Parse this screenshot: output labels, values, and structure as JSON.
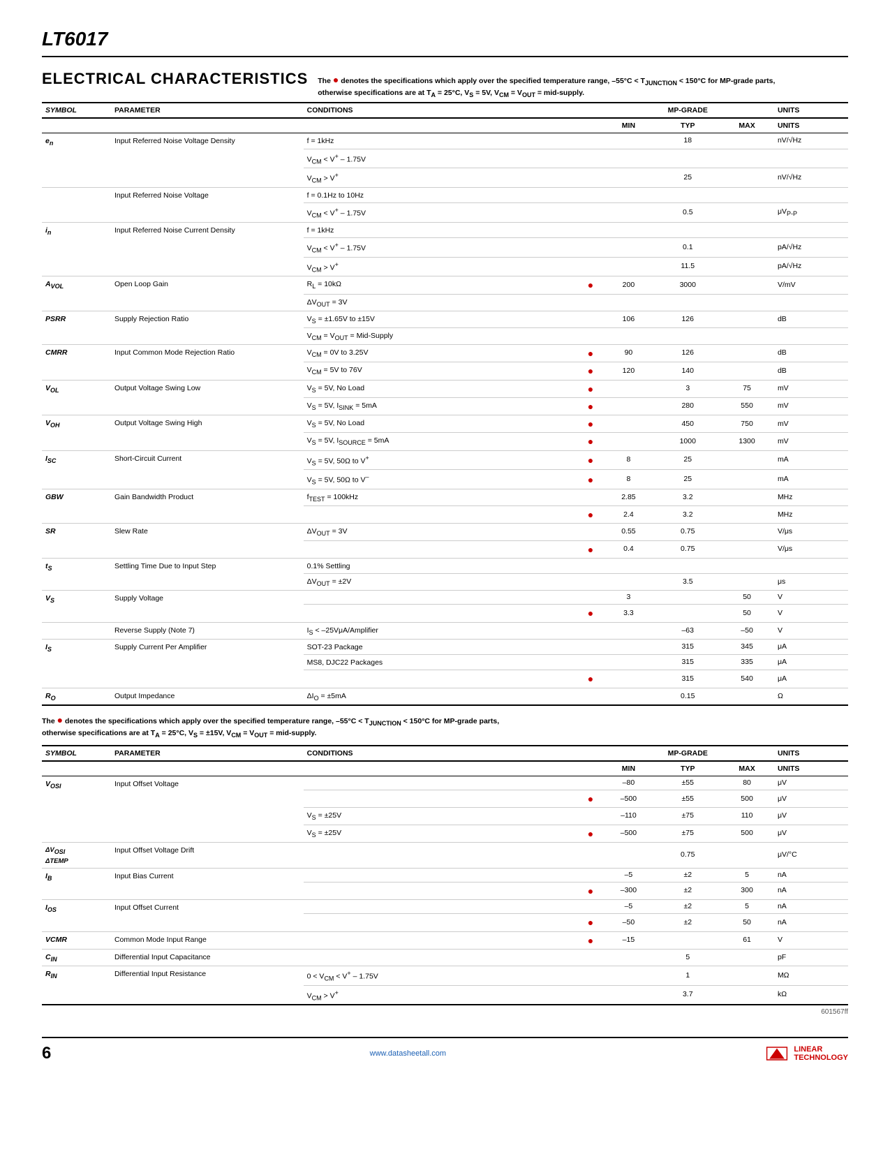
{
  "doc": {
    "title": "LT6017",
    "page": "6",
    "url": "www.datasheetall.com",
    "doc_number": "601567ff"
  },
  "section1": {
    "title": "ELECTRICAL CHARACTERISTICS",
    "desc": "The ● denotes the specifications which apply over the specified temperature range, –55°C < T",
    "desc2": "JUNCTION",
    "desc3": " < 150°C for MP-grade parts, otherwise specifications are at T",
    "desc4": "A",
    "desc5": " = 25°C, V",
    "desc6": "S",
    "desc7": " = 5V, V",
    "desc8": "CM",
    "desc9": " = V",
    "desc10": "OUT",
    "desc11": " = mid-supply.",
    "note": "The ● denotes the specifications which apply over the specified temperature range, –55°C < T",
    "note2": "JUNCTION",
    "note3": " < 150°C for MP-grade parts, otherwise specifications are at T",
    "note4": "A",
    "note5": " = 25°C, V",
    "note6": "S",
    "note7": " = ±15V, V",
    "note8": "CM",
    "note9": " = V",
    "note10": "OUT",
    "note11": " = mid-supply.",
    "table1_cols": [
      "SYMBOL",
      "PARAMETER",
      "CONDITIONS",
      "",
      "MIN",
      "TYP",
      "MAX",
      "UNITS"
    ],
    "table1_rows": [
      {
        "symbol": "en",
        "symbol_sub": "",
        "param": "Input Referred Noise Voltage Density",
        "conds": [
          "f = 1kHz",
          "VCM < V+ – 1.75V",
          "VCM > V+"
        ],
        "dots": [
          "",
          "",
          ""
        ],
        "mins": [
          "",
          "",
          ""
        ],
        "typs": [
          "18",
          "25",
          ""
        ],
        "maxs": [
          "",
          "",
          ""
        ],
        "units": [
          "nV/√Hz",
          "nV/√Hz",
          ""
        ]
      },
      {
        "symbol": "",
        "symbol_sub": "",
        "param": "Input Referred Noise Voltage",
        "conds": [
          "f = 0.1Hz to 10Hz",
          "VCM < V+ – 1.75V"
        ],
        "dots": [
          "",
          ""
        ],
        "mins": [
          "",
          ""
        ],
        "typs": [
          "",
          "0.5"
        ],
        "maxs": [
          "",
          ""
        ],
        "units": [
          "",
          "μVP-P"
        ]
      },
      {
        "symbol": "in",
        "symbol_sub": "",
        "param": "Input Referred Noise Current Density",
        "conds": [
          "f = 1kHz",
          "VCM < V+ – 1.75V",
          "VCM > V+"
        ],
        "dots": [
          "",
          "",
          ""
        ],
        "mins": [
          "",
          "",
          ""
        ],
        "typs": [
          "",
          "0.1",
          "11.5"
        ],
        "maxs": [
          "",
          "",
          ""
        ],
        "units": [
          "",
          "pA/√Hz",
          "pA/√Hz"
        ]
      },
      {
        "symbol": "AVOL",
        "symbol_sub": "",
        "param": "Open Loop Gain",
        "conds": [
          "RL = 10kΩ",
          "ΔVOUT = 3V"
        ],
        "dots": [
          "●",
          ""
        ],
        "mins": [
          "200",
          ""
        ],
        "typs": [
          "3000",
          ""
        ],
        "maxs": [
          "",
          ""
        ],
        "units": [
          "V/mV",
          ""
        ]
      },
      {
        "symbol": "PSRR",
        "symbol_sub": "",
        "param": "Supply Rejection Ratio",
        "conds": [
          "VS = ±1.65V to ±15V",
          "VCM = VOUT = Mid-Supply"
        ],
        "dots": [
          ""
        ],
        "mins": [
          "106"
        ],
        "typs": [
          "126"
        ],
        "maxs": [
          ""
        ],
        "units": [
          "dB"
        ]
      },
      {
        "symbol": "CMRR",
        "symbol_sub": "",
        "param": "Input Common Mode Rejection Ratio",
        "conds": [
          "VCM = 0V to 3.25V",
          "VCM = 5V to 76V"
        ],
        "dots": [
          "●",
          "●"
        ],
        "mins": [
          "90",
          "120"
        ],
        "typs": [
          "126",
          "140"
        ],
        "maxs": [
          "",
          ""
        ],
        "units": [
          "dB",
          "dB"
        ]
      },
      {
        "symbol": "VOL",
        "symbol_sub": "",
        "param": "Output Voltage Swing Low",
        "conds": [
          "VS = 5V, No Load",
          "VS = 5V, ISINK = 5mA"
        ],
        "dots": [
          "●",
          "●"
        ],
        "mins": [
          "",
          ""
        ],
        "typs": [
          "3",
          "280"
        ],
        "maxs": [
          "75",
          "550"
        ],
        "units": [
          "mV",
          "mV"
        ]
      },
      {
        "symbol": "VOH",
        "symbol_sub": "",
        "param": "Output Voltage Swing High",
        "conds": [
          "VS = 5V, No Load",
          "VS = 5V, ISOURCE = 5mA"
        ],
        "dots": [
          "●",
          "●"
        ],
        "mins": [
          "",
          ""
        ],
        "typs": [
          "450",
          "1000"
        ],
        "maxs": [
          "750",
          "1300"
        ],
        "units": [
          "mV",
          "mV"
        ]
      },
      {
        "symbol": "ISC",
        "symbol_sub": "",
        "param": "Short-Circuit Current",
        "conds": [
          "VS = 5V, 50Ω to V+",
          "VS = 5V, 50Ω to V–"
        ],
        "dots": [
          "●",
          "●"
        ],
        "mins": [
          "8",
          "8"
        ],
        "typs": [
          "25",
          "25"
        ],
        "maxs": [
          "",
          ""
        ],
        "units": [
          "mA",
          "mA"
        ]
      },
      {
        "symbol": "GBW",
        "symbol_sub": "",
        "param": "Gain Bandwidth Product",
        "conds": [
          "fTEST = 100kHz",
          ""
        ],
        "dots": [
          "",
          "●"
        ],
        "mins": [
          "2.85",
          "2.4"
        ],
        "typs": [
          "3.2",
          "3.2"
        ],
        "maxs": [
          "",
          ""
        ],
        "units": [
          "MHz",
          "MHz"
        ]
      },
      {
        "symbol": "SR",
        "symbol_sub": "",
        "param": "Slew Rate",
        "conds": [
          "ΔVOUT = 3V",
          ""
        ],
        "dots": [
          "",
          "●"
        ],
        "mins": [
          "0.55",
          "0.4"
        ],
        "typs": [
          "0.75",
          "0.75"
        ],
        "maxs": [
          "",
          ""
        ],
        "units": [
          "V/μs",
          "V/μs"
        ]
      },
      {
        "symbol": "tS",
        "symbol_sub": "",
        "param": "Settling Time Due to Input Step",
        "conds": [
          "0.1% Settling",
          "ΔVOUT = ±2V"
        ],
        "dots": [
          "",
          ""
        ],
        "mins": [
          "",
          ""
        ],
        "typs": [
          "",
          "3.5"
        ],
        "maxs": [
          "",
          ""
        ],
        "units": [
          "",
          "μs"
        ]
      },
      {
        "symbol": "VS",
        "symbol_sub": "",
        "param": "Supply Voltage",
        "conds": [
          "",
          ""
        ],
        "dots": [
          "",
          "●"
        ],
        "mins": [
          "3",
          "3.3"
        ],
        "typs": [
          "",
          ""
        ],
        "maxs": [
          "50",
          "50"
        ],
        "units": [
          "V",
          "V"
        ]
      },
      {
        "symbol": "",
        "symbol_sub": "",
        "param": "Reverse Supply (Note 7)",
        "conds": [
          "IS < –25VμA/Amplifier"
        ],
        "dots": [
          ""
        ],
        "mins": [
          ""
        ],
        "typs": [
          "–63"
        ],
        "maxs": [
          "–50"
        ],
        "units": [
          "V"
        ]
      },
      {
        "symbol": "IS",
        "symbol_sub": "",
        "param": "Supply Current Per Amplifier",
        "conds": [
          "SOT-23 Package",
          "MS8, DJC22 Packages",
          ""
        ],
        "dots": [
          "",
          "",
          "●"
        ],
        "mins": [
          "",
          "",
          ""
        ],
        "typs": [
          "315",
          "315",
          "315"
        ],
        "maxs": [
          "345",
          "335",
          "540"
        ],
        "units": [
          "μA",
          "μA",
          "μA"
        ]
      },
      {
        "symbol": "RO",
        "symbol_sub": "",
        "param": "Output Impedance",
        "conds": [
          "ΔIO = ±5mA"
        ],
        "dots": [
          ""
        ],
        "mins": [
          ""
        ],
        "typs": [
          "0.15"
        ],
        "maxs": [
          ""
        ],
        "units": [
          "Ω"
        ]
      }
    ],
    "table2_rows": [
      {
        "symbol": "VOSI",
        "param": "Input Offset Voltage",
        "conds": [
          "",
          "VS = ±25V",
          "VS = ±25V"
        ],
        "dots": [
          "",
          "●",
          "●"
        ],
        "mins": [
          "–80",
          "–500",
          "–110",
          "–500"
        ],
        "typs": [
          "±55",
          "±55",
          "±75",
          "±75"
        ],
        "maxs": [
          "80",
          "500",
          "110",
          "500"
        ],
        "units": [
          "μV",
          "μV",
          "μV",
          "μV"
        ]
      },
      {
        "symbol": "ΔVOSI/ΔTEMP",
        "param": "Input Offset Voltage Drift",
        "conds": [
          ""
        ],
        "dots": [
          ""
        ],
        "mins": [
          ""
        ],
        "typs": [
          "0.75"
        ],
        "maxs": [
          ""
        ],
        "units": [
          "μV/°C"
        ]
      },
      {
        "symbol": "IB",
        "param": "Input Bias Current",
        "conds": [
          "",
          ""
        ],
        "dots": [
          "",
          "●"
        ],
        "mins": [
          "–5",
          "–300"
        ],
        "typs": [
          "±2",
          "±2"
        ],
        "maxs": [
          "5",
          "300"
        ],
        "units": [
          "nA",
          "nA"
        ]
      },
      {
        "symbol": "IOS",
        "param": "Input Offset Current",
        "conds": [
          "",
          ""
        ],
        "dots": [
          "",
          "●"
        ],
        "mins": [
          "–5",
          "–50"
        ],
        "typs": [
          "±2",
          "±2"
        ],
        "maxs": [
          "5",
          "50"
        ],
        "units": [
          "nA",
          "nA"
        ]
      },
      {
        "symbol": "VCMR",
        "param": "Common Mode Input Range",
        "conds": [
          ""
        ],
        "dots": [
          "●"
        ],
        "mins": [
          "–15"
        ],
        "typs": [
          ""
        ],
        "maxs": [
          "61"
        ],
        "units": [
          "V"
        ]
      },
      {
        "symbol": "CIN",
        "param": "Differential Input Capacitance",
        "conds": [
          ""
        ],
        "dots": [
          ""
        ],
        "mins": [
          ""
        ],
        "typs": [
          "5"
        ],
        "maxs": [
          ""
        ],
        "units": [
          "pF"
        ]
      },
      {
        "symbol": "RIN",
        "param": "Differential Input Resistance",
        "conds": [
          "0 < VCM < V+ – 1.75V",
          "VCM > V+"
        ],
        "dots": [
          "",
          ""
        ],
        "mins": [
          "",
          ""
        ],
        "typs": [
          "1",
          "3.7"
        ],
        "maxs": [
          "",
          ""
        ],
        "units": [
          "MΩ",
          "kΩ"
        ]
      }
    ]
  }
}
